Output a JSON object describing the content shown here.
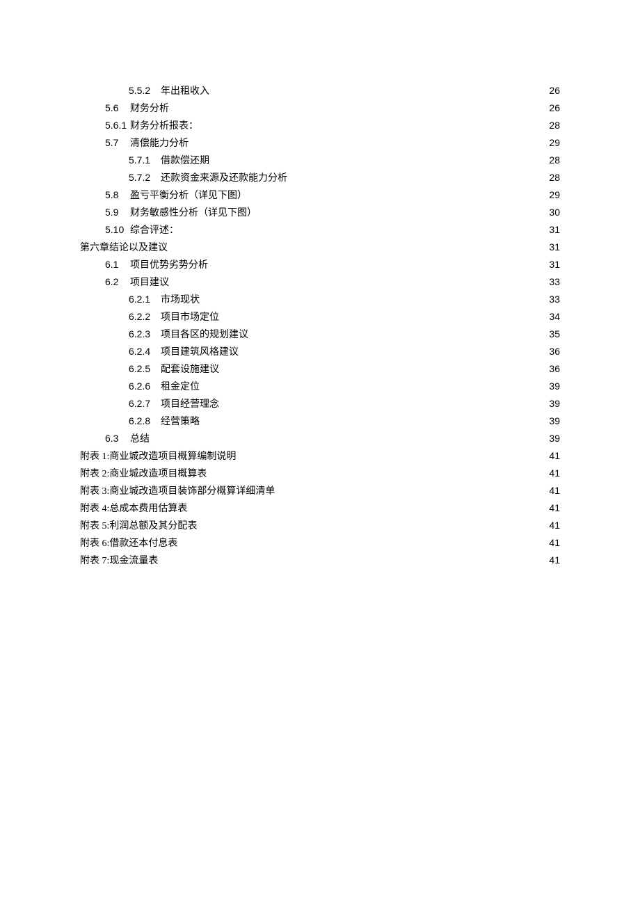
{
  "toc": [
    {
      "indent": 2,
      "num": "5.5.2",
      "title": "年出租收入",
      "page": "26"
    },
    {
      "indent": 1,
      "num": "5.6",
      "title": "财务分析",
      "page": "26",
      "space": true
    },
    {
      "indent": 1,
      "num": "5.6.1",
      "title": "财务分析报表：",
      "page": "28",
      "space": false
    },
    {
      "indent": 1,
      "num": "5.7",
      "title": "清偿能力分析",
      "page": "29",
      "space": true
    },
    {
      "indent": 2,
      "num": "5.7.1",
      "title": "借款偿还期",
      "page": "28"
    },
    {
      "indent": 2,
      "num": "5.7.2",
      "title": "还款资金来源及还款能力分析",
      "page": "28",
      "space": true
    },
    {
      "indent": 1,
      "num": "5.8",
      "title": "盈亏平衡分析（详见下图）",
      "page": "29",
      "space": true
    },
    {
      "indent": 1,
      "num": "5.9",
      "title": "财务敏感性分析（详见下图）",
      "page": "30",
      "space": true
    },
    {
      "indent": 1,
      "num": "5.10",
      "title": "综合评述：",
      "page": "31",
      "space": false
    },
    {
      "indent": 0,
      "num": "",
      "title": "第六章结论以及建议",
      "page": "31"
    },
    {
      "indent": 1,
      "num": "6.1",
      "title": "项目优势劣势分析",
      "page": "31",
      "space": true
    },
    {
      "indent": 1,
      "num": "6.2",
      "title": "项目建议",
      "page": "33",
      "space": true
    },
    {
      "indent": 2,
      "num": "6.2.1",
      "title": "市场现状",
      "page": "33"
    },
    {
      "indent": 2,
      "num": "6.2.2",
      "title": "项目市场定位",
      "page": "34",
      "space": true
    },
    {
      "indent": 2,
      "num": "6.2.3",
      "title": "项目各区的规划建议",
      "page": "35"
    },
    {
      "indent": 2,
      "num": "6.2.4",
      "title": "项目建筑风格建议",
      "page": "36"
    },
    {
      "indent": 2,
      "num": "6.2.5",
      "title": "配套设施建议",
      "page": "36"
    },
    {
      "indent": 2,
      "num": "6.2.6",
      "title": "租金定位",
      "page": "39"
    },
    {
      "indent": 2,
      "num": "6.2.7",
      "title": "项目经营理念",
      "page": "39"
    },
    {
      "indent": 2,
      "num": "6.2.8",
      "title": "经营策略",
      "page": "39"
    },
    {
      "indent": 1,
      "num": "6.3",
      "title": "总结",
      "page": "39",
      "space": true
    },
    {
      "indent": 0,
      "num": "",
      "title": "附表 1:商业城改造项目概算编制说明",
      "page": "41"
    },
    {
      "indent": 0,
      "num": "",
      "title": "附表 2:商业城改造项目概算表",
      "page": "41"
    },
    {
      "indent": 0,
      "num": "",
      "title": "附表 3:商业城改造项目装饰部分概算详细清单",
      "page": "41"
    },
    {
      "indent": 0,
      "num": "",
      "title": "附表 4:总成本费用估算表",
      "page": "41"
    },
    {
      "indent": 0,
      "num": "",
      "title": "附表 5:利润总额及其分配表",
      "page": "41"
    },
    {
      "indent": 0,
      "num": "",
      "title": "附表 6:借款还本付息表",
      "page": "41"
    },
    {
      "indent": 0,
      "num": "",
      "title": "附表 7:现金流量表",
      "page": "41"
    }
  ]
}
